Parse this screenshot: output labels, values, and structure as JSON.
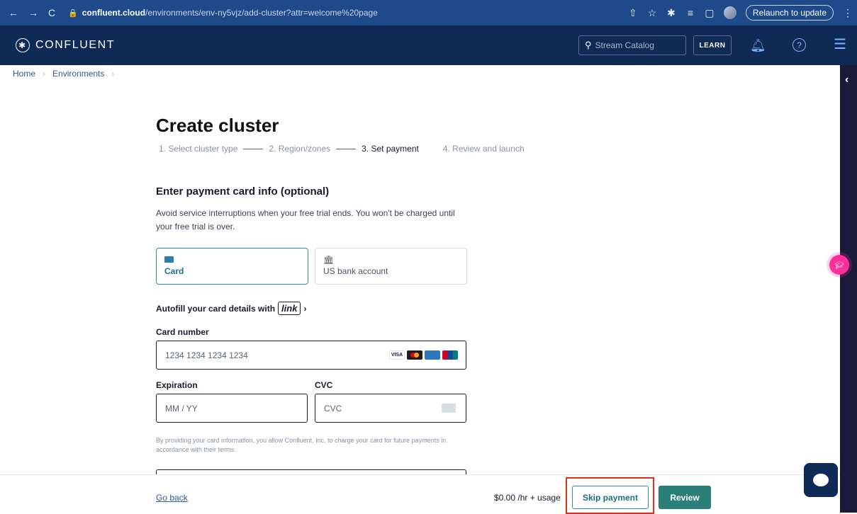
{
  "browser": {
    "host": "confluent.cloud",
    "path": "/environments/env-ny5vjz/add-cluster?attr=welcome%20page",
    "relaunch": "Relaunch to update"
  },
  "header": {
    "brand": "CONFLUENT",
    "search_placeholder": "Stream Catalog",
    "learn": "LEARN"
  },
  "breadcrumb": [
    "Home",
    "Environments"
  ],
  "page": {
    "title": "Create cluster",
    "steps": [
      "1. Select cluster type",
      "2. Region/zones",
      "3. Set payment",
      "4. Review and launch"
    ],
    "section_title": "Enter payment card info (optional)",
    "description": "Avoid service interruptions when your free trial ends. You won't be charged until your free trial is over.",
    "tabs": [
      {
        "label": "Card",
        "icon": "card-icon"
      },
      {
        "label": "US bank account",
        "icon": "bank-icon"
      }
    ],
    "autofill": "Autofill your card details with",
    "link_brand": "link",
    "card_number_label": "Card number",
    "card_number_placeholder": "1234 1234 1234 1234",
    "expiration_label": "Expiration",
    "expiration_placeholder": "MM / YY",
    "cvc_label": "CVC",
    "cvc_placeholder": "CVC",
    "card_brands": [
      "VISA"
    ],
    "legal": "By providing your card information, you allow Confluent, Inc. to charge your card for future payments in accordance with their terms."
  },
  "footer": {
    "go_back": "Go back",
    "price": "$0.00 /hr + usage",
    "skip": "Skip payment",
    "review": "Review"
  },
  "colors": {
    "accent": "#2d8ea6",
    "primary": "#2a7f79",
    "header_bg": "#0f2a54",
    "highlight": "#e0301e"
  }
}
